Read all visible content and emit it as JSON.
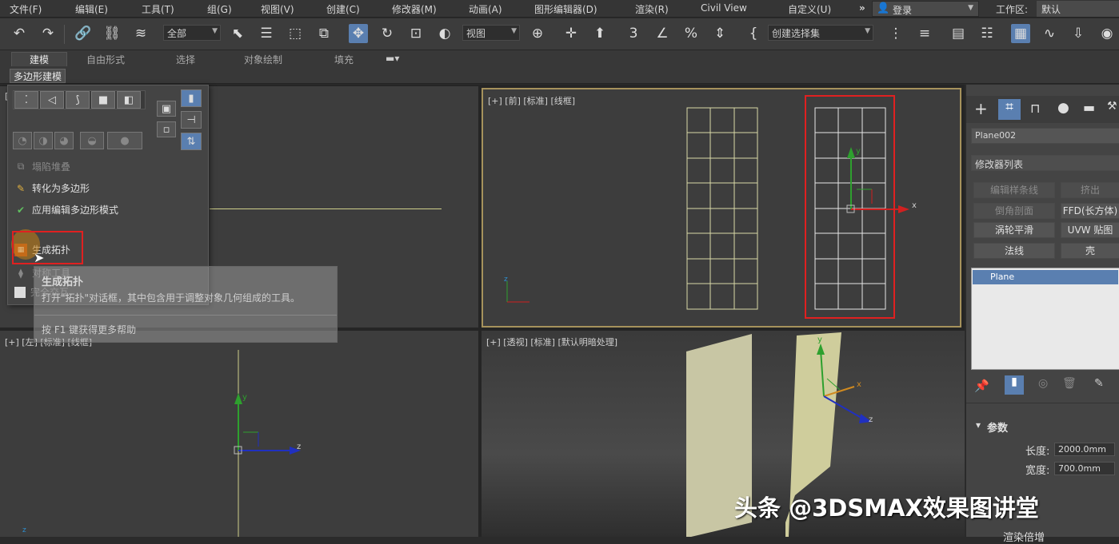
{
  "menubar": {
    "items": [
      "文件(F)",
      "编辑(E)",
      "工具(T)",
      "组(G)",
      "视图(V)",
      "创建(C)",
      "修改器(M)",
      "动画(A)",
      "图形编辑器(D)",
      "渲染(R)",
      "Civil View",
      "自定义(U)"
    ],
    "more": "»",
    "login": "登录",
    "workspace_label": "工作区:",
    "workspace_value": "默认"
  },
  "toolbar": {
    "selection_filter": "全部",
    "ref_coord": "视图",
    "named_selection": "创建选择集"
  },
  "ribbon": {
    "tabs": [
      "建模",
      "自由形式",
      "选择",
      "对象绘制",
      "填充"
    ],
    "panel_label": "多边形建模"
  },
  "dropdown": {
    "items": [
      {
        "label": "塌陷堆叠",
        "enabled": false,
        "icon": "stack-icon"
      },
      {
        "label": "转化为多边形",
        "enabled": true,
        "icon": "convert-icon"
      },
      {
        "label": "应用编辑多边形模式",
        "enabled": true,
        "icon": "check-icon"
      },
      {
        "label": "生成拓扑",
        "enabled": true,
        "icon": "topology-icon"
      }
    ],
    "partial_items": [
      "对称工具",
      "完全交互"
    ]
  },
  "tooltip": {
    "title": "生成拓扑",
    "description": "打开\"拓扑\"对话框，其中包含用于调整对象几何组成的工具。",
    "help": "按 F1 键获得更多帮助"
  },
  "viewports": {
    "top_left_label": "[",
    "front_label": "[+] [前] [标准] [线框]",
    "left_label": "[+] [左] [标准] [线框]",
    "persp_label": "[+] [透视] [标准] [默认明暗处理]",
    "axis_x": "x",
    "axis_y": "y",
    "axis_z": "z"
  },
  "command_panel": {
    "object_name": "Plane002",
    "modifier_list": "修改器列表",
    "mod_buttons": [
      {
        "label": "编辑样条线",
        "enabled": false
      },
      {
        "label": "挤出",
        "enabled": false
      },
      {
        "label": "倒角剖面",
        "enabled": false
      },
      {
        "label": "FFD(长方体)",
        "enabled": true
      },
      {
        "label": "涡轮平滑",
        "enabled": true
      },
      {
        "label": "UVW 贴图",
        "enabled": true
      },
      {
        "label": "法线",
        "enabled": true
      },
      {
        "label": "壳",
        "enabled": true
      }
    ],
    "stack_item": "Plane",
    "params_title": "参数",
    "length_label": "长度:",
    "length_value": "2000.0mm",
    "width_label": "宽度:",
    "width_value": "700.0mm",
    "cut_label": "渲染倍增"
  },
  "watermark": "头条 @3DSMAX效果图讲堂",
  "colors": {
    "accent": "#5a7fb0",
    "highlight_red": "#e02020",
    "wire_yellow": "#d9d9a8",
    "wire_white": "#e6e6e6"
  }
}
